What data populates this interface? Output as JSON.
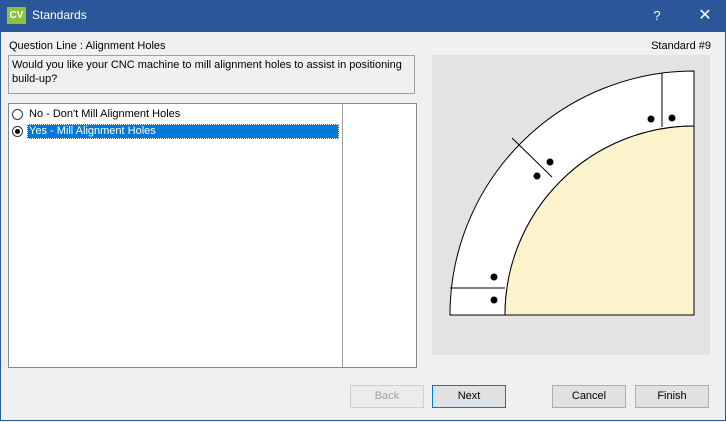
{
  "window": {
    "icon_text": "CV",
    "title": "Standards",
    "help_glyph": "?",
    "close_glyph": "✕"
  },
  "header": {
    "question_line": "Question Line : Alignment Holes",
    "standard_number": "Standard #9"
  },
  "question": {
    "text": "Would you like your CNC machine to mill alignment holes to assist in positioning build-up?"
  },
  "options": [
    {
      "label": "No - Don't Mill Alignment Holes",
      "selected": false
    },
    {
      "label": "Yes - Mill Alignment Holes",
      "selected": true
    }
  ],
  "buttons": {
    "back": "Back",
    "next": "Next",
    "cancel": "Cancel",
    "finish": "Finish"
  },
  "colors": {
    "titlebar": "#2b579a",
    "selection": "#0078d7",
    "countertop_fill": "#fcf3cc",
    "buildup_fill": "#ffffff",
    "preview_bg": "#e3e3e3"
  }
}
